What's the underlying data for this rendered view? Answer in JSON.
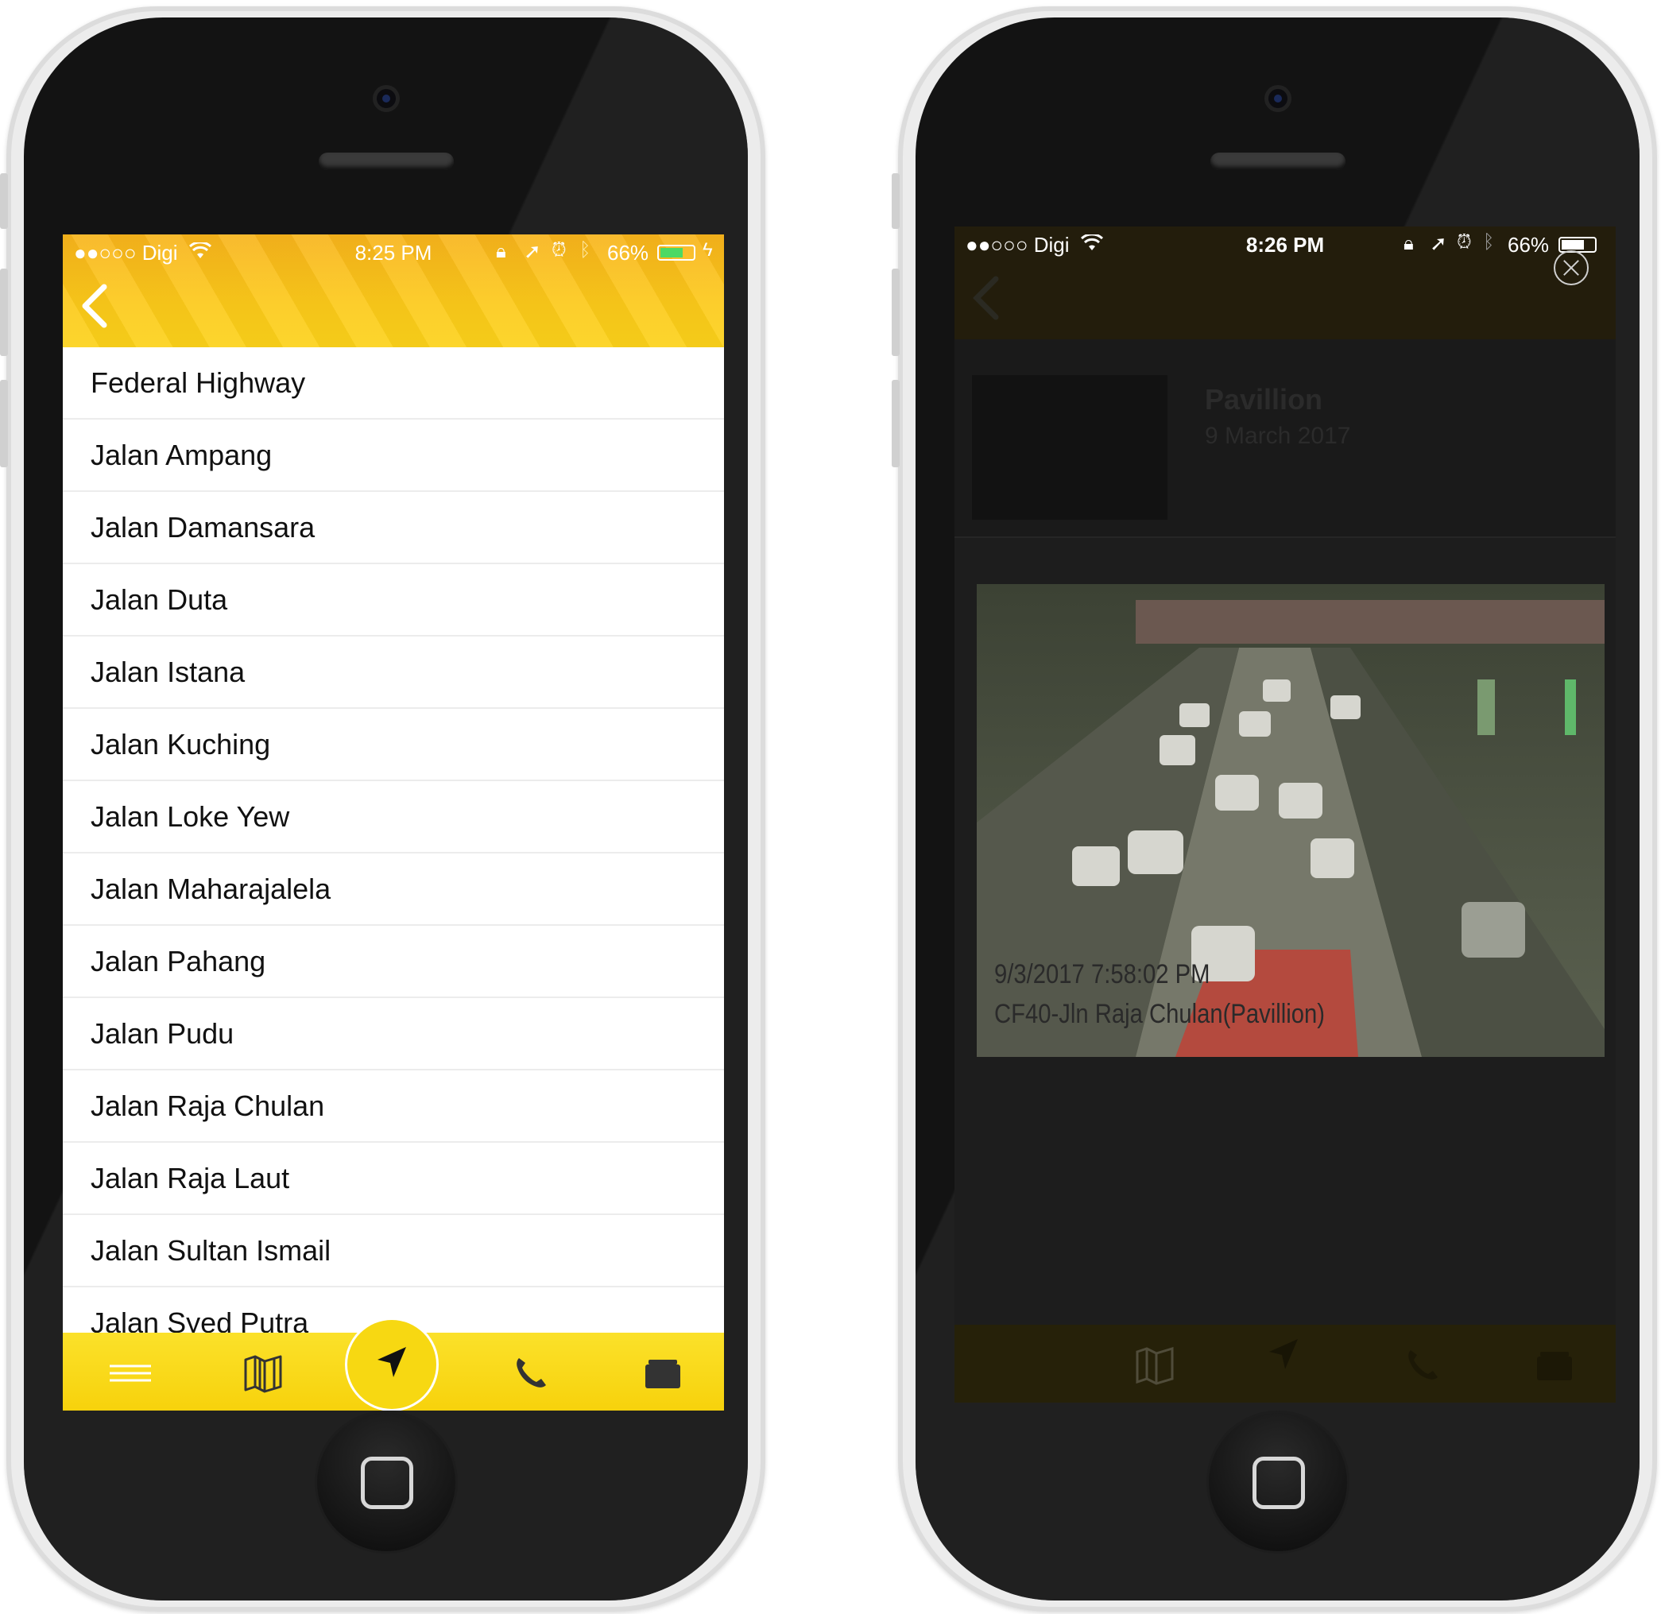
{
  "left_phone": {
    "status": {
      "carrier": "●●○○○ Digi",
      "time": "8:25 PM",
      "battery": "66%"
    },
    "roads": [
      "Federal Highway",
      "Jalan Ampang",
      "Jalan Damansara",
      "Jalan Duta",
      "Jalan Istana",
      "Jalan Kuching",
      "Jalan Loke Yew",
      "Jalan Maharajalela",
      "Jalan Pahang",
      "Jalan Pudu",
      "Jalan Raja Chulan",
      "Jalan Raja Laut",
      "Jalan Sultan Ismail",
      "Jalan Syed Putra"
    ],
    "tabs": [
      "menu-icon",
      "map-icon",
      "navigate-icon",
      "phone-icon",
      "wallet-icon"
    ],
    "accent": "#fcc91a"
  },
  "right_phone": {
    "status": {
      "carrier": "●●○○○ Digi",
      "time": "8:26 PM",
      "battery": "66%"
    },
    "card": {
      "title": "Pavillion",
      "date": "9 March 2017"
    },
    "camera": {
      "timestamp": "9/3/2017 7:58:02 PM",
      "location": "CF40-Jln Raja Chulan(Pavillion)"
    }
  }
}
